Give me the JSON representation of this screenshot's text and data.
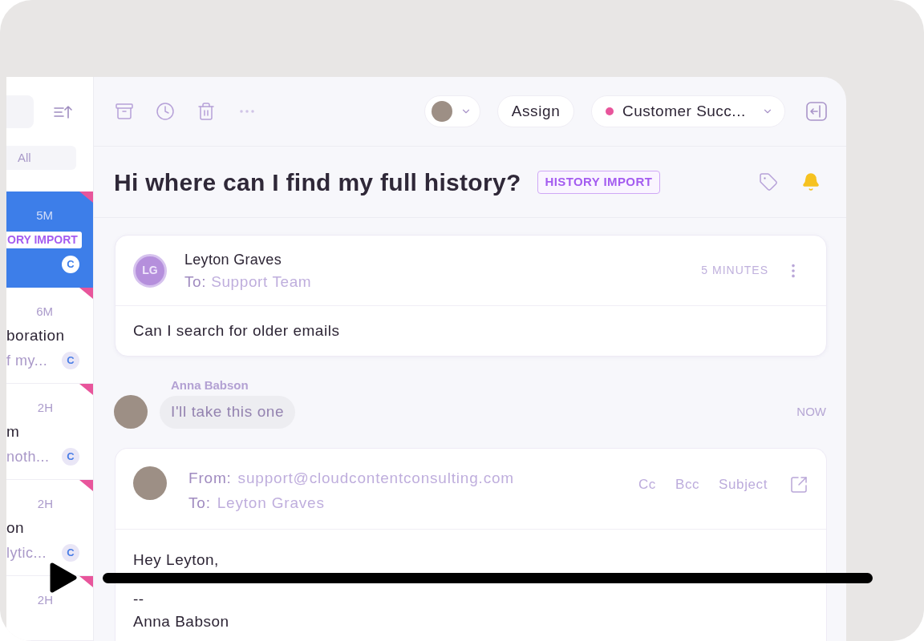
{
  "sidebar": {
    "filter": {
      "label": "All"
    },
    "conversations": [
      {
        "selected": true,
        "flagged": true,
        "time": "5M",
        "tag": "ORY IMPORT",
        "badge": "C"
      },
      {
        "selected": false,
        "flagged": true,
        "time": "6M",
        "title": "boration",
        "preview": "f my...",
        "badge": "C"
      },
      {
        "selected": false,
        "flagged": true,
        "time": "2H",
        "title": "m",
        "preview": "noth...",
        "badge": "C"
      },
      {
        "selected": false,
        "flagged": true,
        "time": "2H",
        "title": "on",
        "preview": "lytic...",
        "badge": "C"
      },
      {
        "selected": false,
        "flagged": true,
        "time": "2H"
      }
    ]
  },
  "toolbar": {
    "assign_button": "Assign",
    "inbox": "Customer Succ..."
  },
  "conversation": {
    "title": "Hi where can I find my full history?",
    "tag": "HISTORY IMPORT"
  },
  "messages": [
    {
      "kind": "email",
      "initials": "LG",
      "sender": "Leyton Graves",
      "to_label": "To:",
      "to": "Support Team",
      "time": "5 MINUTES",
      "body": "Can I search for older emails"
    },
    {
      "kind": "note",
      "author": "Anna Babson",
      "text": "I'll take this one",
      "time": "NOW"
    }
  ],
  "reply": {
    "from_label": "From:",
    "from": "support@cloudcontentconsulting.com",
    "to_label": "To:",
    "to": "Leyton Graves",
    "fields": [
      "Cc",
      "Bcc",
      "Subject"
    ],
    "body": [
      "Hey Leyton,",
      "--",
      "Anna Babson"
    ]
  }
}
